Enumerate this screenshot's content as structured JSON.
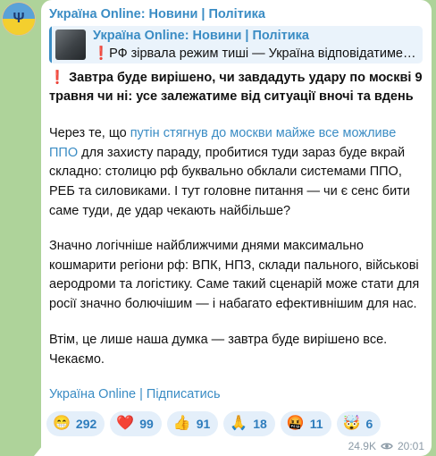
{
  "channel": {
    "name": "Україна Online: Новини | Політика"
  },
  "reply": {
    "title": "Україна Online: Новини | Політика",
    "mark": "❗",
    "text": "РФ зірвала режим тиші — Україна відповідатиме дзеркально"
  },
  "message": {
    "headline_mark": "❗",
    "headline": "Завтра буде вирішено, чи завдадуть удару по москві 9 травня чи ні: усе залежатиме від ситуації вночі та вдень",
    "p1_before": "Через те, що ",
    "p1_link": "путін стягнув до москви майже все можливе ППО",
    "p1_after": " для захисту параду, пробитися туди зараз буде вкрай складно: столицю рф буквально обклали системами ППО, РЕБ та силовиками. І тут головне питання — чи є сенс бити саме туди, де удар чекають найбільше?",
    "p2": "Значно логічніше найближчими днями максимально кошмарити регіони рф: ВПК, НПЗ, склади пального, військові аеродроми та логістику. Саме такий сценарій може стати для росії значно болючішим — і набагато ефективнішим для нас.",
    "p3": "Втім, це лише наша думка — завтра буде вирішено все. Чекаємо.",
    "subscribe_link": "Україна Online | Підписатись"
  },
  "reactions": [
    {
      "icon": "grin-emoji-icon",
      "emoji": "😁",
      "count": "292"
    },
    {
      "icon": "heart-emoji-icon",
      "emoji": "❤️",
      "count": "99"
    },
    {
      "icon": "thumbs-up-emoji-icon",
      "emoji": "👍",
      "count": "91"
    },
    {
      "icon": "praying-hands-emoji-icon",
      "emoji": "🙏",
      "count": "18"
    },
    {
      "icon": "angry-face-emoji-icon",
      "emoji": "🤬",
      "count": "11"
    },
    {
      "icon": "exploding-head-emoji-icon",
      "emoji": "🤯",
      "count": "6"
    }
  ],
  "footer": {
    "views": "24.9K",
    "time": "20:01"
  },
  "colors": {
    "background": "#aed39a",
    "accent": "#3a8cc4",
    "alert_red": "#e0212d",
    "reaction_bg": "#e4effa"
  }
}
